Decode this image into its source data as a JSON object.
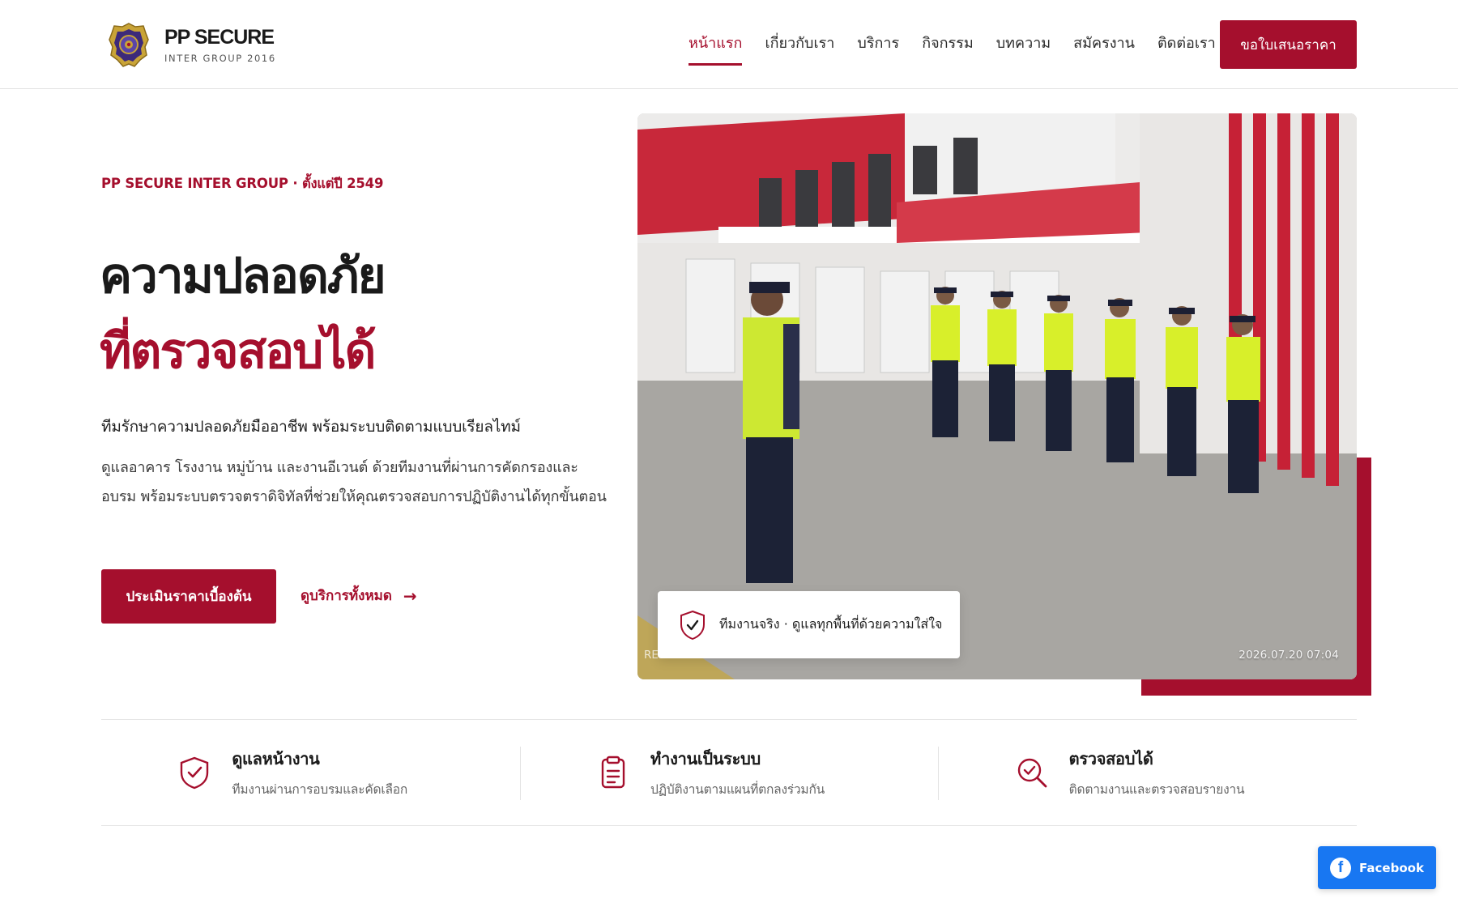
{
  "brand": {
    "name": "PP SECURE",
    "tagline": "INTER GROUP 2016",
    "logo_icon": "police-badge-icon",
    "accent_color": "#a50f2d"
  },
  "nav": {
    "items": [
      {
        "label": "หน้าแรก",
        "active": true
      },
      {
        "label": "เกี่ยวกับเรา",
        "active": false
      },
      {
        "label": "บริการ",
        "active": false
      },
      {
        "label": "กิจกรรม",
        "active": false
      },
      {
        "label": "บทความ",
        "active": false
      },
      {
        "label": "สมัครงาน",
        "active": false
      },
      {
        "label": "ติดต่อเรา",
        "active": false
      }
    ],
    "cta_label": "ขอใบเสนอราคา"
  },
  "hero": {
    "eyebrow": "PP SECURE INTER GROUP · ตั้งแต่ปี 2549",
    "headline_line1": "ความปลอดภัย",
    "headline_line2": "ที่ตรวจสอบได้",
    "lead": "ทีมรักษาความปลอดภัยมืออาชีพ พร้อมระบบติดตามแบบเรียลไทม์",
    "description": "ดูแลอาคาร โรงงาน หมู่บ้าน และงานอีเวนต์ ด้วยทีมงานที่ผ่านการคัดกรองและอบรม พร้อมระบบตรวจตราดิจิทัลที่ช่วยให้คุณตรวจสอบการปฏิบัติงานได้ทุกขั้นตอน",
    "primary_cta": "ประเมินราคาเบื้องต้น",
    "secondary_cta": "ดูบริการทั้งหมด",
    "secondary_icon": "arrow-right-icon"
  },
  "photo": {
    "timestamp": "2026.07.20 07:04",
    "watermark": "REC",
    "caption": "ทีมงานจริง · ดูแลทุกพื้นที่ด้วยความใส่ใจ",
    "caption_icon": "shield-check-icon"
  },
  "features": [
    {
      "title": "ดูแลหน้างาน",
      "subtitle": "ทีมงานผ่านการอบรมและคัดเลือก",
      "icon": "shield-check-icon"
    },
    {
      "title": "ทำงานเป็นระบบ",
      "subtitle": "ปฏิบัติงานตามแผนที่ตกลงร่วมกัน",
      "icon": "clipboard-icon"
    },
    {
      "title": "ตรวจสอบได้",
      "subtitle": "ติดตามงานและตรวจสอบรายงาน",
      "icon": "search-check-icon"
    }
  ],
  "social": {
    "facebook_label": "Facebook",
    "facebook_icon": "facebook-icon",
    "facebook_color": "#1877f2"
  }
}
